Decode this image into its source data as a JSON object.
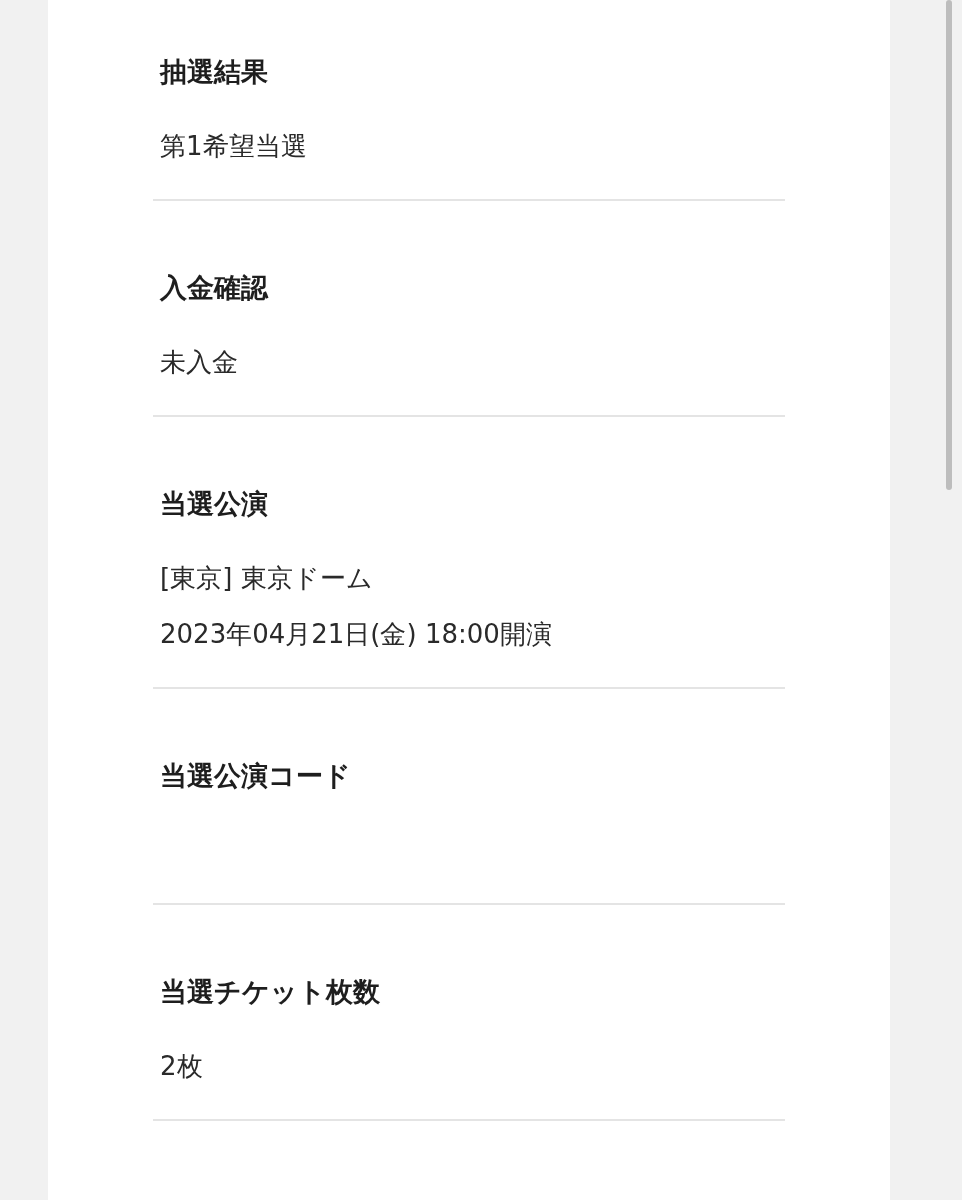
{
  "sections": [
    {
      "label": "抽選結果",
      "lines": [
        "第1希望当選"
      ]
    },
    {
      "label": "入金確認",
      "lines": [
        "未入金"
      ]
    },
    {
      "label": "当選公演",
      "lines": [
        "[東京] 東京ドーム",
        "2023年04月21日(金) 18:00開演"
      ]
    },
    {
      "label": "当選公演コード"
    },
    {
      "label": "当選チケット枚数",
      "lines": [
        "2枚"
      ]
    }
  ]
}
